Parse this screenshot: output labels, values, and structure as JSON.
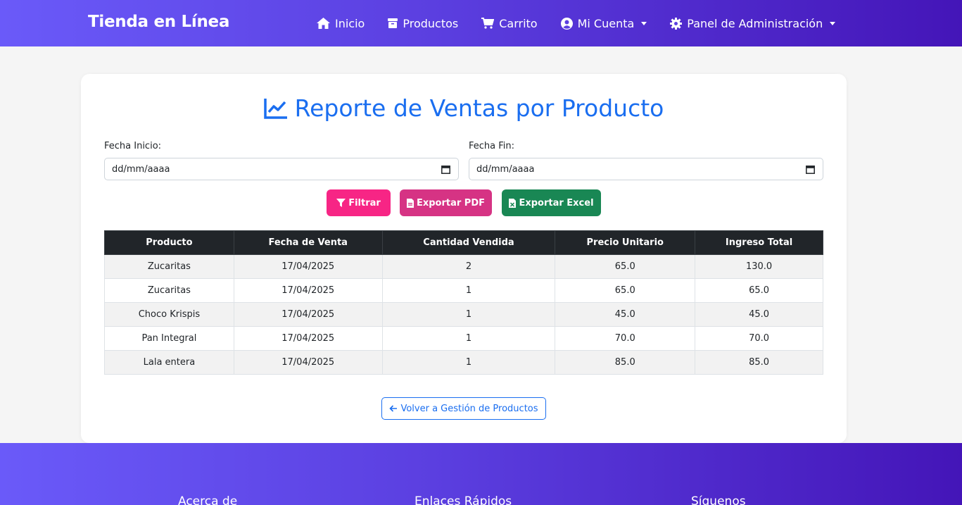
{
  "navbar": {
    "brand": "Tienda en Línea",
    "items": [
      {
        "label": "Inicio",
        "icon": "home-icon"
      },
      {
        "label": "Productos",
        "icon": "box-icon"
      },
      {
        "label": "Carrito",
        "icon": "cart-icon"
      },
      {
        "label": "Mi Cuenta",
        "icon": "user-circle-icon",
        "dropdown": true
      },
      {
        "label": "Panel de Administración",
        "icon": "gear-icon",
        "dropdown": true
      }
    ]
  },
  "report": {
    "title": "Reporte de Ventas por Producto",
    "start_label": "Fecha Inicio:",
    "start_value": "dd/mm/aaaa",
    "end_label": "Fecha Fin:",
    "end_value": "dd/mm/aaaa",
    "filter_label": "Filtrar",
    "pdf_label": "Exportar PDF",
    "excel_label": "Exportar Excel"
  },
  "table": {
    "headers": [
      "Producto",
      "Fecha de Venta",
      "Cantidad Vendida",
      "Precio Unitario",
      "Ingreso Total"
    ],
    "rows": [
      [
        "Zucaritas",
        "17/04/2025",
        "2",
        "65.0",
        "130.0"
      ],
      [
        "Zucaritas",
        "17/04/2025",
        "1",
        "65.0",
        "65.0"
      ],
      [
        "Choco Krispis",
        "17/04/2025",
        "1",
        "45.0",
        "45.0"
      ],
      [
        "Pan Integral",
        "17/04/2025",
        "1",
        "70.0",
        "70.0"
      ],
      [
        "Lala entera",
        "17/04/2025",
        "1",
        "85.0",
        "85.0"
      ]
    ]
  },
  "back_label": "Volver a Gestión de Productos",
  "footer": {
    "about": "Acerca de",
    "links": "Enlaces Rápidos",
    "follow": "Síguenos"
  },
  "colors": {
    "accent": "#1a6ef0",
    "filter_btn": "#f72585",
    "pdf_btn": "#d63384",
    "excel_btn": "#198754",
    "table_header": "#212529"
  }
}
